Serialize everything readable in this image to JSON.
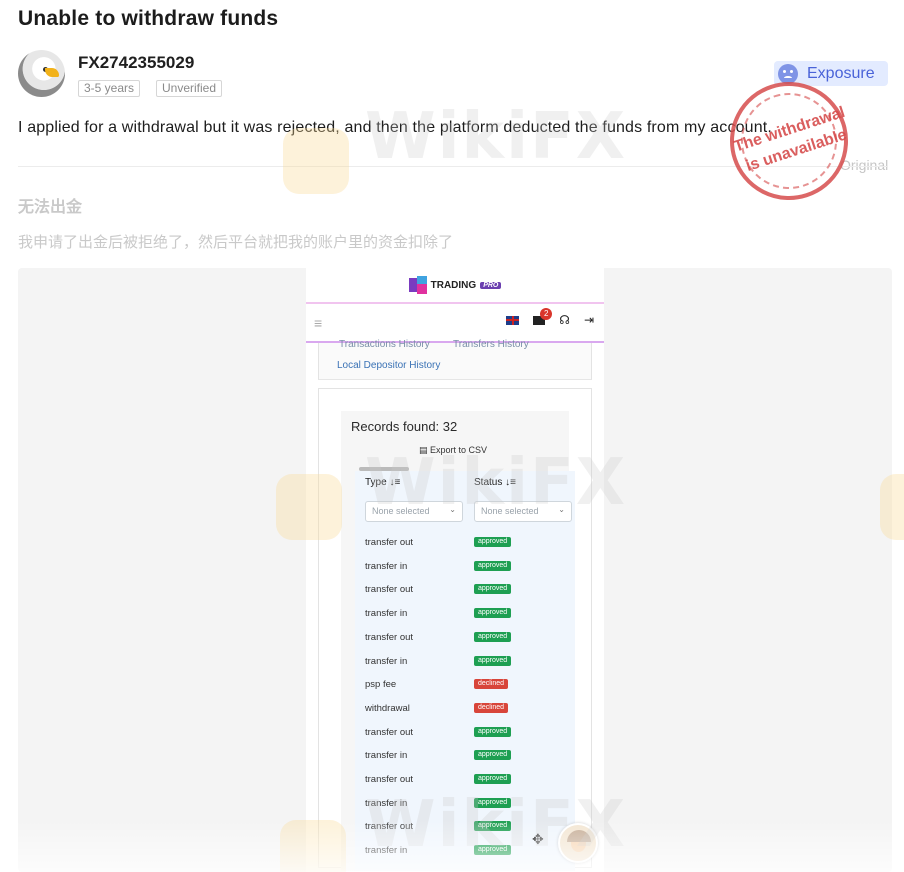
{
  "post": {
    "title": "Unable to withdraw funds",
    "author": "FX2742355029",
    "tags": [
      "3-5 years",
      "Unverified"
    ],
    "exposure_label": "Exposure",
    "content_en": "I applied for a withdrawal but it was rejected, and then the platform deducted the funds from my account.",
    "original_label": "Original",
    "title_cn": "无法出金",
    "content_cn": "我申请了出金后被拒绝了，然后平台就把我的账户里的资金扣除了"
  },
  "stamp": {
    "line1": "The withdrawal",
    "line2": "is unavailable"
  },
  "watermark": {
    "text": "WikiFX"
  },
  "screenshot": {
    "logo_text": "TRADING",
    "logo_badge": "PRO",
    "mail_badge": "2",
    "tabs": [
      "Transactions History",
      "Transfers History"
    ],
    "local_tab": "Local Depositor History",
    "records_label": "Records found: 32",
    "export_label": "Export to CSV",
    "col_type": "Type",
    "col_status": "Status",
    "filter_placeholder": "None selected",
    "rows": [
      {
        "type": "transfer out",
        "status": "approved"
      },
      {
        "type": "transfer in",
        "status": "approved"
      },
      {
        "type": "transfer out",
        "status": "approved"
      },
      {
        "type": "transfer in",
        "status": "approved"
      },
      {
        "type": "transfer out",
        "status": "approved"
      },
      {
        "type": "transfer in",
        "status": "approved"
      },
      {
        "type": "psp fee",
        "status": "declined"
      },
      {
        "type": "withdrawal",
        "status": "declined"
      },
      {
        "type": "transfer out",
        "status": "approved"
      },
      {
        "type": "transfer in",
        "status": "approved"
      },
      {
        "type": "transfer out",
        "status": "approved"
      },
      {
        "type": "transfer in",
        "status": "approved"
      },
      {
        "type": "transfer out",
        "status": "approved"
      },
      {
        "type": "transfer in",
        "status": "approved"
      }
    ]
  },
  "colors": {
    "accent": "#4a63d8",
    "approved": "#1e9f52",
    "declined": "#d8453a",
    "stamp": "#d64c4c"
  }
}
